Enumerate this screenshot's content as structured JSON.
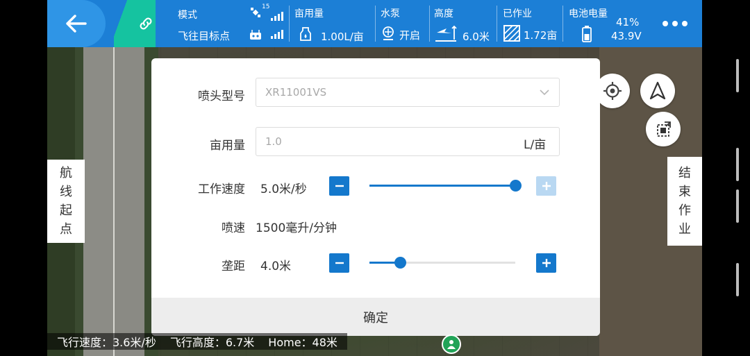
{
  "topbar": {
    "mode_label": "模式",
    "mode_value": "飞往目标点",
    "gps_count": "15",
    "acre_usage_label": "亩用量",
    "acre_usage_value": "1.00L/亩",
    "pump_label": "水泵",
    "pump_value": "开启",
    "height_label": "高度",
    "height_value": "6.0米",
    "worked_label": "已作业",
    "worked_value": "1.72亩",
    "battery_label": "电池电量",
    "battery_percent": "41%",
    "battery_voltage": "43.9V",
    "more_icon": "more-dots-icon",
    "accent_color": "#1c7fd6"
  },
  "side": {
    "start_label": [
      "航",
      "线",
      "起",
      "点"
    ],
    "end_label": [
      "结",
      "束",
      "作",
      "业"
    ]
  },
  "dialog": {
    "nozzle_label": "喷头型号",
    "nozzle_value": "XR11001VS",
    "acre_label": "亩用量",
    "acre_value": "1.0",
    "acre_unit": "L/亩",
    "speed_label": "工作速度",
    "speed_value": "5.0米/秒",
    "speed_fraction": 1.0,
    "spray_label": "喷速",
    "spray_value": "1500毫升/分钟",
    "spacing_label": "垄距",
    "spacing_value": "4.0米",
    "spacing_fraction": 0.21,
    "confirm_label": "确定",
    "accent_color": "#1478cc"
  },
  "status": {
    "flight_speed": "飞行速度：3.6米/秒",
    "flight_height": "飞行高度：6.7米",
    "home": "Home：48米"
  }
}
